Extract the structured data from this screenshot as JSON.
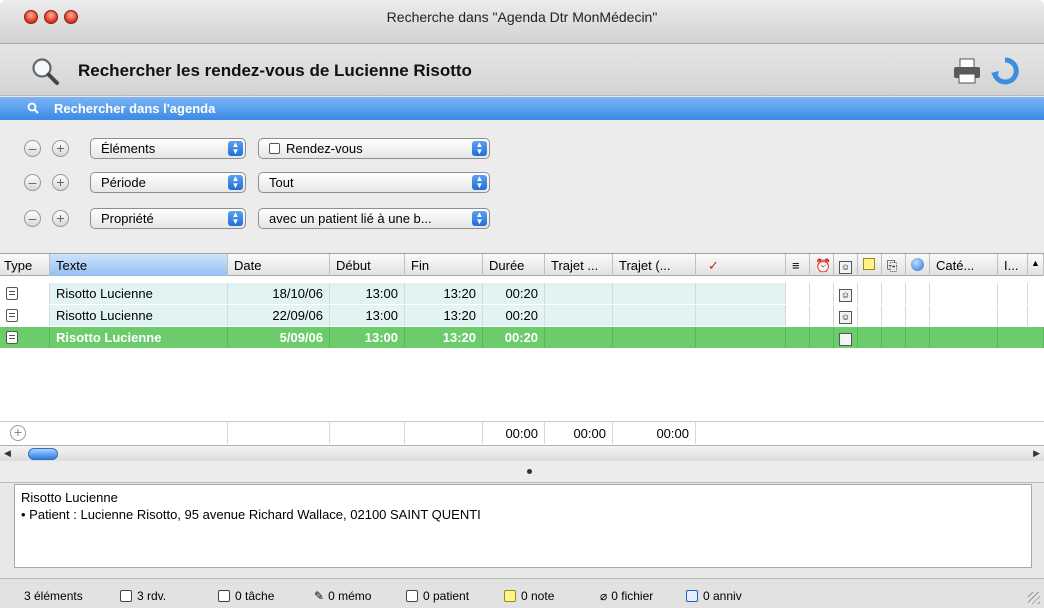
{
  "window": {
    "title": "Recherche dans \"Agenda Dtr MonMédecin\""
  },
  "header": {
    "title": "Rechercher les rendez-vous de Lucienne Risotto"
  },
  "search_bar": {
    "label": "Rechercher dans l'agenda"
  },
  "criteria": [
    {
      "field": "Éléments",
      "value": "Rendez-vous"
    },
    {
      "field": "Période",
      "value": "Tout"
    },
    {
      "field": "Propriété",
      "value": "avec un patient lié à une b..."
    }
  ],
  "table": {
    "columns": [
      "Type",
      "Texte",
      "Date",
      "Début",
      "Fin",
      "Durée",
      "Trajet ...",
      "Trajet (...",
      "✓",
      "Caté...",
      "I..."
    ],
    "rows": [
      {
        "text": "Risotto Lucienne",
        "date": "18/10/06",
        "start": "13:00",
        "end": "13:20",
        "duration": "00:20"
      },
      {
        "text": "Risotto Lucienne",
        "date": "22/09/06",
        "start": "13:00",
        "end": "13:20",
        "duration": "00:20"
      },
      {
        "text": "Risotto Lucienne",
        "date": "5/09/06",
        "start": "13:00",
        "end": "13:20",
        "duration": "00:20"
      }
    ],
    "totals": {
      "duration": "00:00",
      "trajet1": "00:00",
      "trajet2": "00:00"
    }
  },
  "detail": {
    "name": "Risotto Lucienne",
    "line": "• Patient : Lucienne Risotto, 95 avenue Richard Wallace, 02100 SAINT QUENTI"
  },
  "status": {
    "elements": "3 éléments",
    "rdv": "3 rdv.",
    "tasks": "0 tâche",
    "memos": "0 mémo",
    "patients": "0 patient",
    "notes": "0 note",
    "files": "0 fichier",
    "anniv": "0 anniv"
  },
  "colors": {
    "accent_blue": "#3a8ae6",
    "selected_row": "#6ccc6c",
    "row_tint": "#e2f3f3",
    "checkmark": "#c0281a"
  }
}
